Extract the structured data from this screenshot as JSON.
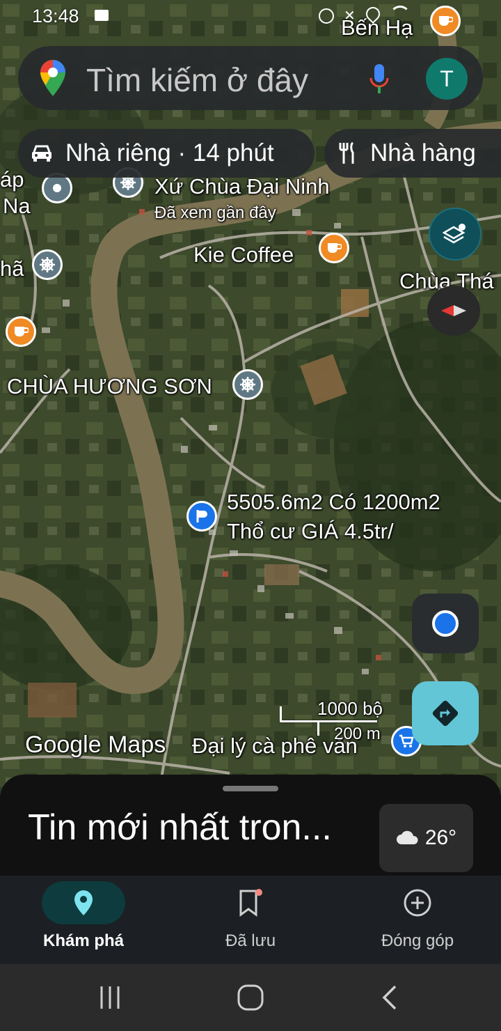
{
  "status_bar": {
    "time": "13:48"
  },
  "search": {
    "placeholder": "Tìm kiếm ở đây",
    "avatar_letter": "T"
  },
  "chips": [
    {
      "label": "Nhà riêng · 14 phút",
      "icon": "car-icon"
    },
    {
      "label": "Nhà hàng",
      "icon": "restaurant-icon"
    }
  ],
  "map_labels": {
    "ben_ha": "Bến Hạ",
    "xu_chua": "Xứ Chùa Đại Ninh",
    "recent": "Đã xem gần đây",
    "kie_coffee": "Kie Coffee",
    "chua_tha": "Chùa Thá",
    "chua_huong_son": "CHÙA HƯƠNG SƠN",
    "listing_line1": "5505.6m2 Có 1200m2",
    "listing_line2": "Thổ cư GIÁ  4.5tr/",
    "dai_ly": "Đại lý cà phê văn",
    "left_1": "áp",
    "left_2": "Na",
    "left_3": "hã",
    "google_maps": "Google Maps"
  },
  "scale": {
    "feet": "1000 bộ",
    "meters": "200 m"
  },
  "sheet": {
    "title": "Tin mới nhất tron...",
    "temperature": "26°"
  },
  "bottom_nav": [
    {
      "label": "Khám phá",
      "active": true
    },
    {
      "label": "Đã lưu",
      "active": false
    },
    {
      "label": "Đóng góp",
      "active": false
    }
  ],
  "colors": {
    "accent_teal": "#0f7a6c",
    "coffee_pin": "#f08a24",
    "location_blue": "#1a73e8",
    "directions": "#62c6d6"
  }
}
